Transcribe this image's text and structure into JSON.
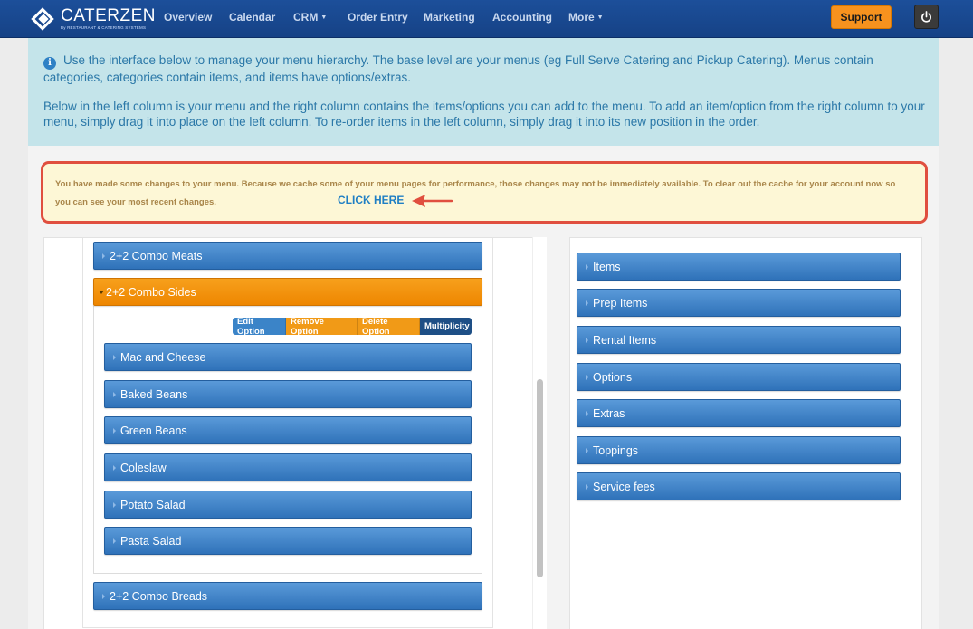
{
  "nav": {
    "logo_name": "CATERZEN",
    "logo_sub": "By RESTAURANT & CATERING SYSTEMS",
    "items": [
      "Overview",
      "Calendar",
      "CRM",
      "Order Entry",
      "Marketing",
      "Accounting",
      "More"
    ],
    "support_label": "Support"
  },
  "info": {
    "p1": "Use the interface below to manage your menu hierarchy. The base level are your menus (eg Full Serve Catering and Pickup Catering). Menus contain categories, categories contain items, and items have options/extras.",
    "p2": "Below in the left column is your menu and the right column contains the items/options you can add to the menu. To add an item/option from the right column to your menu, simply drag it into place on the left column. To re-order items in the left column, simply drag it into its new position in the order."
  },
  "alert": {
    "text": "You have made some changes to your menu. Because we cache some of your menu pages for performance, those changes may not be immediately available. To clear out the cache for your account now so you can see your most recent changes,",
    "link": "CLICK HERE"
  },
  "left": {
    "groups": [
      "2+2 Combo Meats",
      "2+2 Combo Sides",
      "2+2 Combo Breads"
    ],
    "option_buttons": {
      "edit": "Edit Option",
      "remove": "Remove Option",
      "delete": "Delete Option",
      "multiplicity": "Multiplicity"
    },
    "items": [
      "Mac and Cheese",
      "Baked Beans",
      "Green Beans",
      "Coleslaw",
      "Potato Salad",
      "Pasta Salad"
    ]
  },
  "right": {
    "items": [
      "Items",
      "Prep Items",
      "Rental Items",
      "Options",
      "Extras",
      "Toppings",
      "Service fees"
    ]
  },
  "colors": {
    "nav_bg": "#1a4a93",
    "support": "#f7921e",
    "bar_blue": "#3b80c4",
    "bar_orange": "#f19217",
    "alert_border": "#e04f3f"
  }
}
